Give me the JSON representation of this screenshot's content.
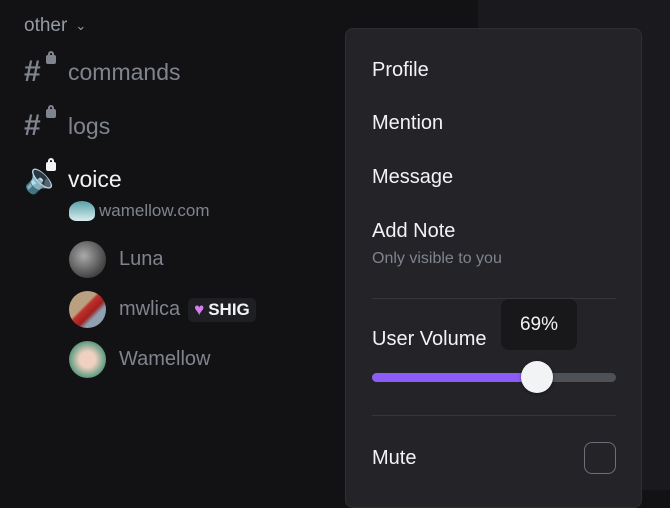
{
  "sidebar": {
    "category": "other",
    "channels": [
      {
        "name": "commands",
        "icon": "locked-text-channel-icon"
      },
      {
        "name": "logs",
        "icon": "locked-text-channel-icon"
      },
      {
        "name": "voice",
        "icon": "locked-voice-channel-icon"
      }
    ],
    "voice_status": "wamellow.com",
    "voice_users": [
      {
        "name": "Luna"
      },
      {
        "name": "mwlica",
        "tag": "SHIG",
        "tag_icon": "purple-heart-icon"
      },
      {
        "name": "Wamellow"
      }
    ]
  },
  "menu": {
    "items": [
      "Profile",
      "Mention",
      "Message",
      "Add Note"
    ],
    "note_hint": "Only visible to you",
    "volume_label": "User Volume",
    "volume_value": 69,
    "volume_tooltip": "69%",
    "mute_label": "Mute",
    "mute_checked": false,
    "accent": "#8b5cf6"
  }
}
